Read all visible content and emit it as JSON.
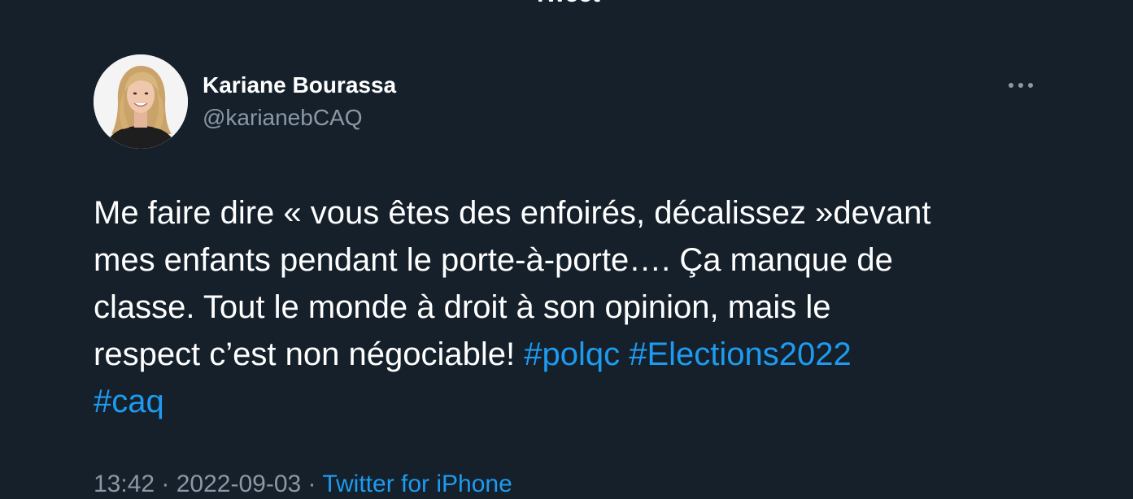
{
  "header": {
    "title": "Tweet"
  },
  "author": {
    "display_name": "Kariane Bourassa",
    "handle": "@karianebCAQ"
  },
  "tweet": {
    "lines": [
      "Me faire dire «  vous êtes des enfoirés, décalissez »devant",
      "mes enfants pendant le porte-à-porte…. Ça manque de",
      "classe. Tout le monde à droit à son opinion, mais le",
      "respect c’est non négociable! "
    ],
    "hashtags": [
      "#polqc",
      "#Elections2022",
      "#caq"
    ]
  },
  "meta": {
    "time": "13:42",
    "separator": " · ",
    "date": "2022-09-03",
    "source": "Twitter for iPhone"
  },
  "colors": {
    "background": "#15202b",
    "text": "#ffffff",
    "secondary": "#8b98a5",
    "accent": "#1d9bf0"
  },
  "icons": {
    "back": "back-arrow-icon",
    "more": "more-options-icon"
  }
}
